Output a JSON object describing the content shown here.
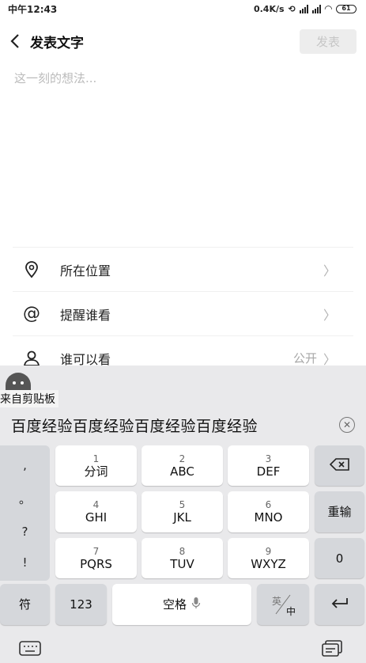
{
  "status": {
    "time": "中午12:43",
    "speed": "0.4K/s",
    "battery": "61"
  },
  "header": {
    "title": "发表文字",
    "publish_label": "发表"
  },
  "editor": {
    "placeholder": "这一刻的想法..."
  },
  "options": [
    {
      "icon": "location-pin-icon",
      "label": "所在位置",
      "value": ""
    },
    {
      "icon": "at-sign-icon",
      "label": "提醒谁看",
      "value": ""
    },
    {
      "icon": "person-icon",
      "label": "谁可以看",
      "value": "公开"
    }
  ],
  "keyboard": {
    "clipboard_label": "来自剪贴板",
    "suggestion": "百度经验百度经验百度经验百度经验",
    "punct": [
      ",",
      "。",
      "?",
      "!"
    ],
    "keys": {
      "k1": {
        "num": "1",
        "label": "分词"
      },
      "k2": {
        "num": "2",
        "label": "ABC"
      },
      "k3": {
        "num": "3",
        "label": "DEF"
      },
      "k4": {
        "num": "4",
        "label": "GHI"
      },
      "k5": {
        "num": "5",
        "label": "JKL"
      },
      "k6": {
        "num": "6",
        "label": "MNO"
      },
      "k7": {
        "num": "7",
        "label": "PQRS"
      },
      "k8": {
        "num": "8",
        "label": "TUV"
      },
      "k9": {
        "num": "9",
        "label": "WXYZ"
      }
    },
    "retype": "重输",
    "zero": "0",
    "symbol": "符",
    "num_toggle": "123",
    "space": "空格",
    "lang_en": "英",
    "lang_zh": "中"
  }
}
